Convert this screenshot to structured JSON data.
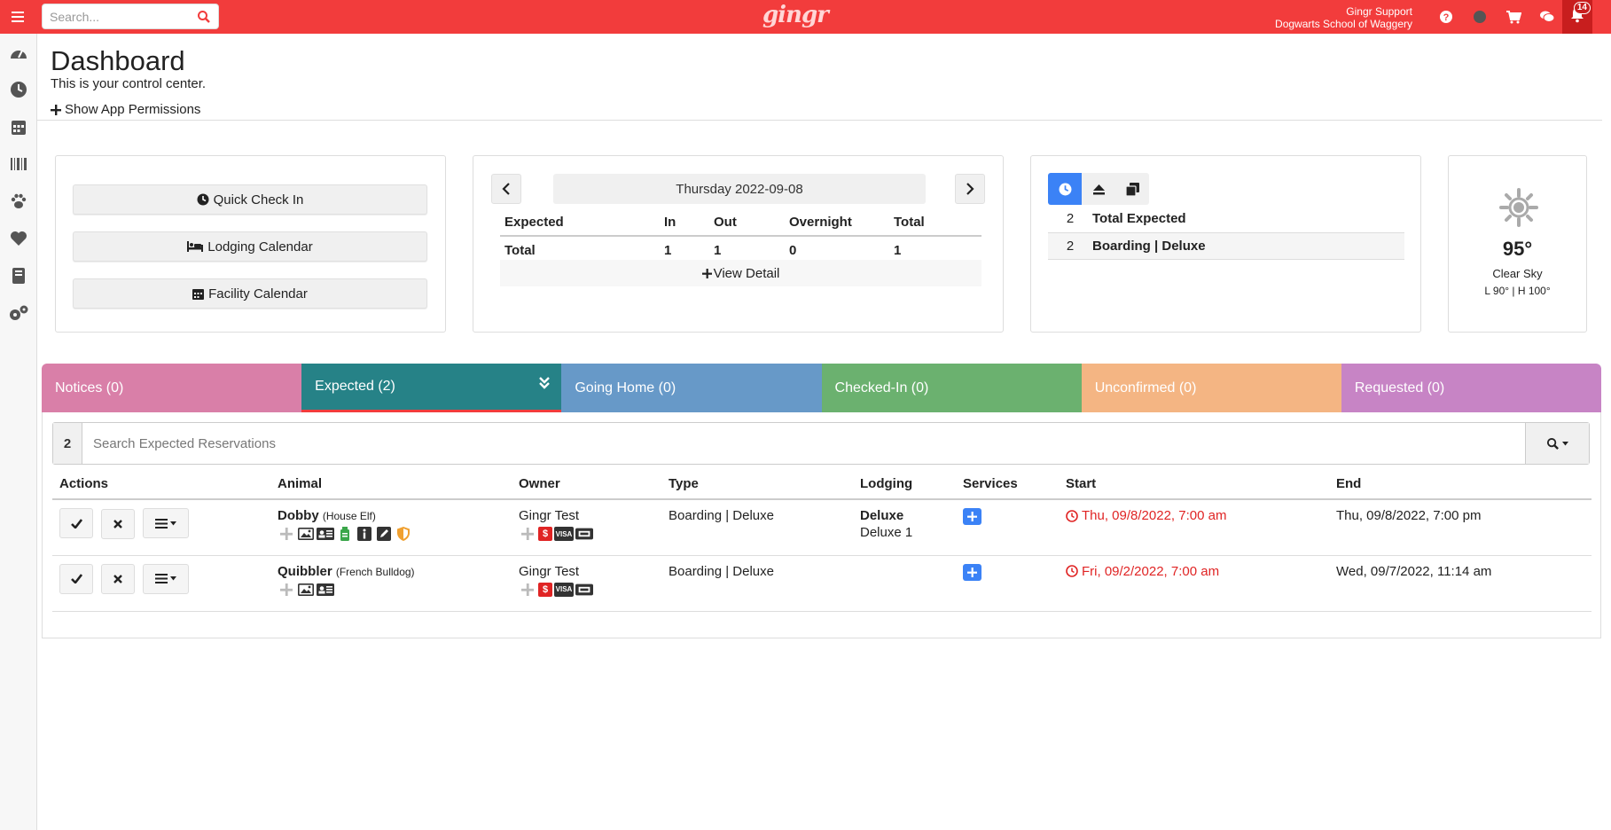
{
  "topbar": {
    "search_placeholder": "Search...",
    "brand": "gingr",
    "user_name": "Gingr Support",
    "business_name": "Dogwarts School of Waggery",
    "notification_count": "14",
    "icons": [
      "help-icon",
      "status-dot-icon",
      "cart-icon",
      "chat-icon",
      "bell-icon"
    ]
  },
  "sidebar": {
    "items": [
      "dashboard-icon",
      "clock-icon",
      "calendar-icon",
      "barcode-icon",
      "paw-icon",
      "heart-icon",
      "book-icon",
      "settings-icon"
    ]
  },
  "header": {
    "title": "Dashboard",
    "subtitle": "This is your control center.",
    "permissions_link": "Show App Permissions"
  },
  "quick_links": {
    "check_in": "Quick Check In",
    "lodging_calendar": "Lodging Calendar",
    "facility_calendar": "Facility Calendar"
  },
  "expected_panel": {
    "date": "Thursday 2022-09-08",
    "columns": [
      "Expected",
      "In",
      "Out",
      "Overnight",
      "Total"
    ],
    "row": [
      "Total",
      "1",
      "1",
      "0",
      "1"
    ],
    "view_detail": "View Detail"
  },
  "summary_panel": {
    "rows": [
      {
        "count": "2",
        "label": "Total Expected"
      },
      {
        "count": "2",
        "label": "Boarding | Deluxe"
      }
    ]
  },
  "weather": {
    "temp": "95°",
    "condition": "Clear Sky",
    "range": "L 90° | H 100°"
  },
  "tabs": [
    {
      "label": "Notices (0)",
      "color": "#d97fa8"
    },
    {
      "label": "Expected (2)",
      "color": "#268287"
    },
    {
      "label": "Going Home (0)",
      "color": "#6799c8"
    },
    {
      "label": "Checked-In (0)",
      "color": "#6bb16f"
    },
    {
      "label": "Unconfirmed (0)",
      "color": "#f4b583"
    },
    {
      "label": "Requested (0)",
      "color": "#c784c5"
    }
  ],
  "reservations": {
    "count": "2",
    "search_placeholder": "Search Expected Reservations",
    "columns": [
      "Actions",
      "Animal",
      "Owner",
      "Type",
      "Lodging",
      "Services",
      "Start",
      "End"
    ],
    "rows": [
      {
        "animal": "Dobby",
        "breed": "(House Elf)",
        "owner": "Gingr Test",
        "type": "Boarding | Deluxe",
        "lodging": "Deluxe",
        "lodging_unit": "Deluxe 1",
        "start": "Thu, 09/8/2022, 7:00 am",
        "end": "Thu, 09/8/2022, 7:00 pm"
      },
      {
        "animal": "Quibbler",
        "breed": "(French Bulldog)",
        "owner": "Gingr Test",
        "type": "Boarding | Deluxe",
        "lodging": "",
        "lodging_unit": "",
        "start": "Fri, 09/2/2022, 7:00 am",
        "end": "Wed, 09/7/2022, 11:14 am"
      }
    ],
    "owner_badges": [
      "$",
      "VISA"
    ]
  }
}
